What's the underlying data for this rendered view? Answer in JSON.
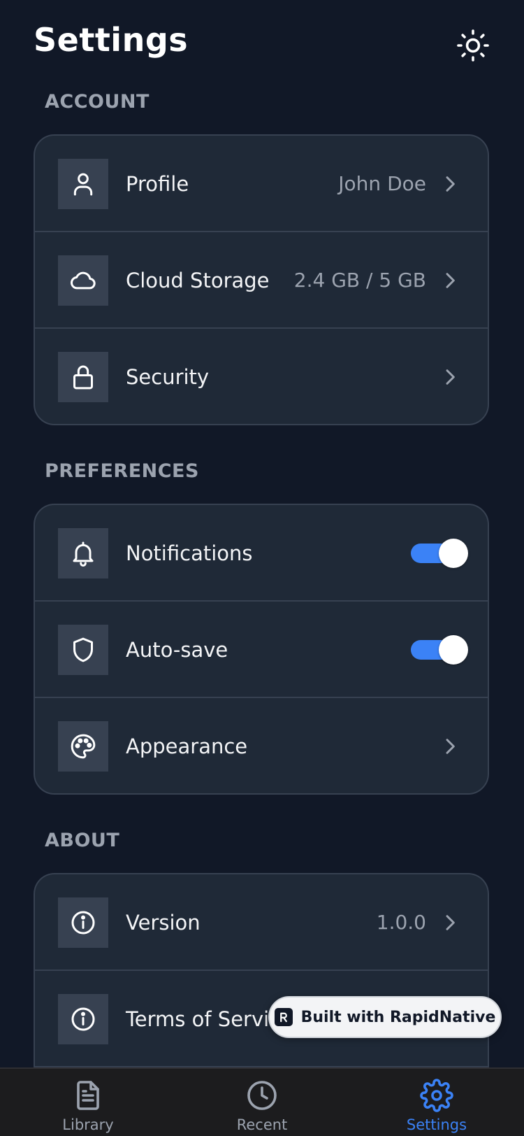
{
  "header": {
    "title": "Settings",
    "theme_icon": "sun-icon"
  },
  "sections": {
    "account": {
      "label": "ACCOUNT",
      "items": [
        {
          "label": "Profile",
          "value": "John Doe",
          "icon": "user-icon"
        },
        {
          "label": "Cloud Storage",
          "value": "2.4 GB / 5 GB",
          "icon": "cloud-icon"
        },
        {
          "label": "Security",
          "value": "",
          "icon": "lock-icon"
        }
      ]
    },
    "preferences": {
      "label": "PREFERENCES",
      "items": [
        {
          "label": "Notifications",
          "toggle": true,
          "icon": "bell-icon"
        },
        {
          "label": "Auto-save",
          "toggle": true,
          "icon": "shield-icon"
        },
        {
          "label": "Appearance",
          "icon": "palette-icon"
        }
      ]
    },
    "about": {
      "label": "ABOUT",
      "items": [
        {
          "label": "Version",
          "value": "1.0.0",
          "icon": "info-icon"
        },
        {
          "label": "Terms of Service",
          "icon": "info-icon"
        }
      ]
    }
  },
  "badge": {
    "text": "Built with RapidNative",
    "icon": "rapidnative-logo-icon"
  },
  "tabbar": {
    "items": [
      {
        "label": "Library",
        "icon": "document-icon",
        "active": false
      },
      {
        "label": "Recent",
        "icon": "clock-icon",
        "active": false
      },
      {
        "label": "Settings",
        "icon": "gear-icon",
        "active": true
      }
    ]
  },
  "colors": {
    "background": "#111827",
    "card": "#1f2937",
    "accent": "#3b82f6",
    "muted_text": "#9ca3af",
    "tab_inactive": "#9ca3af"
  }
}
